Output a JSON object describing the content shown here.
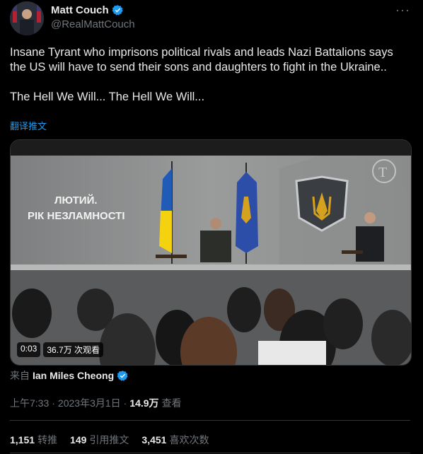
{
  "author": {
    "name": "Matt Couch",
    "handle": "@RealMattCouch"
  },
  "tweet": {
    "text": "Insane Tyrant who imprisons political rivals and leads Nazi Battalions says the US will have to send their sons and daughters to fight in the Ukraine..\n\nThe Hell We Will... The Hell We Will...",
    "translate_label": "翻译推文"
  },
  "video": {
    "time": "0:03",
    "views": "36.7万 次观看",
    "banner_line1": "ЛЮТИЙ.",
    "banner_line2": "РІК НЕЗЛАМНОСТІ"
  },
  "source": {
    "prefix": "来自",
    "name": "Ian Miles Cheong"
  },
  "meta": {
    "time": "上午7:33",
    "date": "2023年3月1日",
    "views_count": "14.9万",
    "views_label": "查看"
  },
  "stats": [
    {
      "num": "1,151",
      "label": "转推"
    },
    {
      "num": "149",
      "label": "引用推文"
    },
    {
      "num": "3,451",
      "label": "喜欢次数"
    }
  ],
  "colors": {
    "background": "#000000",
    "text": "#e7e9ea",
    "secondary": "#71767b",
    "accent": "#1d9bf0",
    "divider": "#2f3336"
  }
}
